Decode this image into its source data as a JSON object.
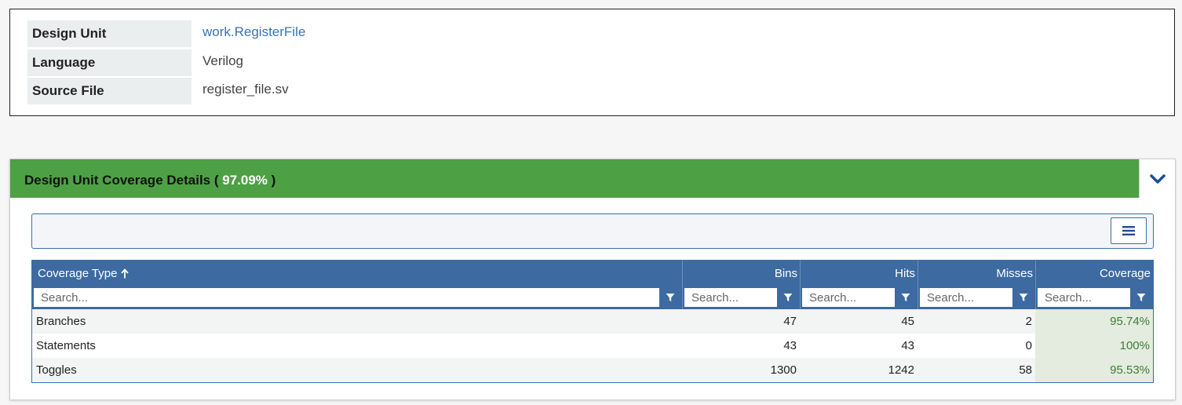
{
  "info": {
    "rows": [
      {
        "key": "Design Unit",
        "value": "work.RegisterFile"
      },
      {
        "key": "Language",
        "value": "Verilog"
      },
      {
        "key": "Source File",
        "value": "register_file.sv"
      }
    ]
  },
  "coverage": {
    "title": "Design Unit Coverage Details",
    "open_paren": "(",
    "percent": "97.09%",
    "close_paren": ")",
    "collapse_icon": "chevron-down-icon",
    "menu_icon": "hamburger-menu-icon",
    "colors": {
      "header": "#4ea045",
      "table_header": "#3d6aa0",
      "link": "#3a73b3",
      "coverage_cell": "#e3ecde",
      "coverage_text": "#3f7c3a"
    }
  },
  "table": {
    "columns": [
      {
        "label": "Coverage Type",
        "sort": "ascending",
        "placeholder": "Search..."
      },
      {
        "label": "Bins",
        "placeholder": "Search..."
      },
      {
        "label": "Hits",
        "placeholder": "Search..."
      },
      {
        "label": "Misses",
        "placeholder": "Search..."
      },
      {
        "label": "Coverage",
        "placeholder": "Search..."
      }
    ],
    "rows": [
      {
        "type": "Branches",
        "bins": "47",
        "hits": "45",
        "misses": "2",
        "coverage": "95.74%"
      },
      {
        "type": "Statements",
        "bins": "43",
        "hits": "43",
        "misses": "0",
        "coverage": "100%"
      },
      {
        "type": "Toggles",
        "bins": "1300",
        "hits": "1242",
        "misses": "58",
        "coverage": "95.53%"
      }
    ]
  }
}
